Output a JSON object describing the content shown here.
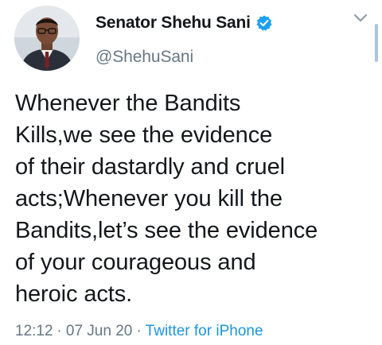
{
  "author": {
    "display_name": "Senator Shehu Sani",
    "handle": "@ShehuSani",
    "verified": true
  },
  "tweet": {
    "lines": [
      "Whenever the Bandits",
      "Kills,we see the evidence",
      "of their dastardly and cruel",
      "acts;Whenever you kill the",
      "Bandits,let’s see the evidence",
      "of your courageous and",
      "heroic acts."
    ]
  },
  "meta": {
    "time": "12:12",
    "date": "07 Jun 20",
    "separator": "·",
    "source": "Twitter for iPhone"
  },
  "icons": {
    "verified": "verified-badge-icon",
    "caret": "chevron-down-icon"
  },
  "colors": {
    "text": "#14171a",
    "secondary": "#657786",
    "link": "#1b95e0",
    "verified": "#1da1f2"
  }
}
